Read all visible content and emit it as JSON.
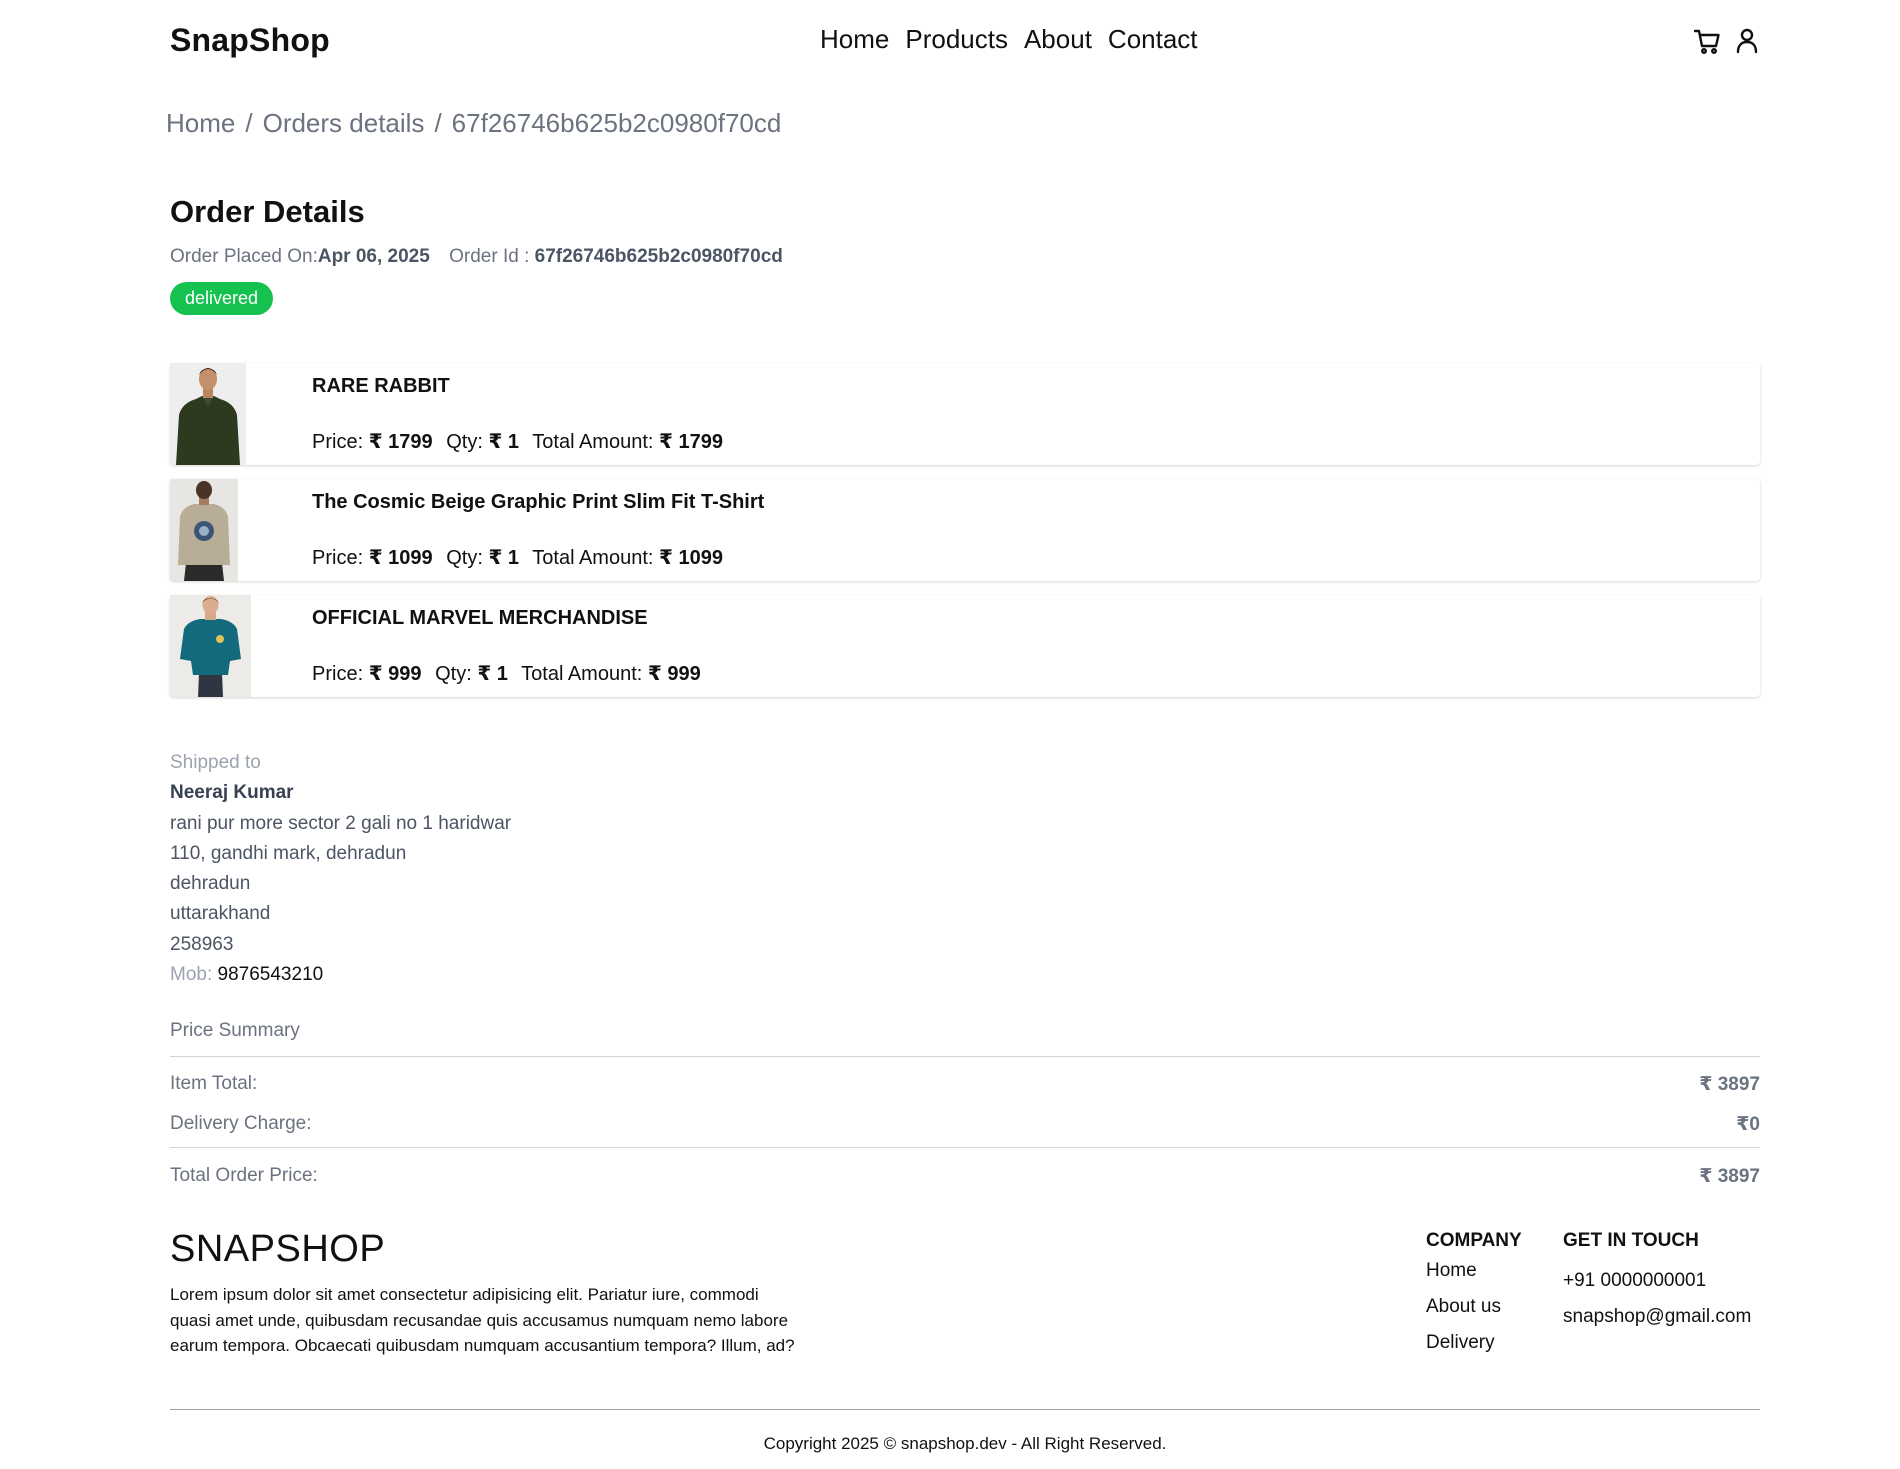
{
  "header": {
    "logo": "SnapShop",
    "nav": [
      "Home",
      "Products",
      "About",
      "Contact"
    ]
  },
  "breadcrumb": {
    "items": [
      "Home",
      "Orders details",
      "67f26746b625b2c0980f70cd"
    ],
    "separator": "/"
  },
  "order": {
    "title": "Order Details",
    "placed_label": "Order Placed On:",
    "placed_date": "Apr 06, 2025",
    "id_label": "Order Id :",
    "id_value": "67f26746b625b2c0980f70cd",
    "status": "delivered",
    "status_color": "#16c24f"
  },
  "items": [
    {
      "name": "RARE RABBIT",
      "price_label": "Price:",
      "price": "₹ 1799",
      "qty_label": "Qty:",
      "qty": "₹ 1",
      "total_label": "Total Amount:",
      "total": "₹ 1799"
    },
    {
      "name": "The Cosmic Beige Graphic Print Slim Fit T-Shirt",
      "price_label": "Price:",
      "price": "₹ 1099",
      "qty_label": "Qty:",
      "qty": "₹ 1",
      "total_label": "Total Amount:",
      "total": "₹ 1099"
    },
    {
      "name": "OFFICIAL MARVEL MERCHANDISE",
      "price_label": "Price:",
      "price": "₹ 999",
      "qty_label": "Qty:",
      "qty": "₹ 1",
      "total_label": "Total Amount:",
      "total": "₹ 999"
    }
  ],
  "shipping": {
    "label": "Shipped to",
    "name": "Neeraj Kumar",
    "address1": "rani pur more sector 2 gali no 1 haridwar",
    "address2": "110, gandhi mark, dehradun",
    "city": "dehradun",
    "state": "uttarakhand",
    "pincode": "258963",
    "mob_label": "Mob:",
    "mob": "9876543210"
  },
  "summary": {
    "title": "Price Summary",
    "item_total_label": "Item Total:",
    "item_total": "₹ 3897",
    "delivery_label": "Delivery Charge:",
    "delivery": "₹0",
    "order_total_label": "Total Order Price:",
    "order_total": "₹ 3897"
  },
  "footer": {
    "logo": "SNAPSHOP",
    "description": "Lorem ipsum dolor sit amet consectetur adipisicing elit. Pariatur iure, commodi quasi amet unde, quibusdam recusandae quis accusamus numquam nemo labore earum tempora. Obcaecati quibusdam numquam accusantium tempora? Illum, ad?",
    "company_title": "COMPANY",
    "company_links": [
      "Home",
      "About us",
      "Delivery"
    ],
    "contact_title": "GET IN TOUCH",
    "phone": "+91 0000000001",
    "email": "snapshop@gmail.com",
    "copyright": "Copyright 2025 © snapshop.dev - All Right Reserved."
  }
}
